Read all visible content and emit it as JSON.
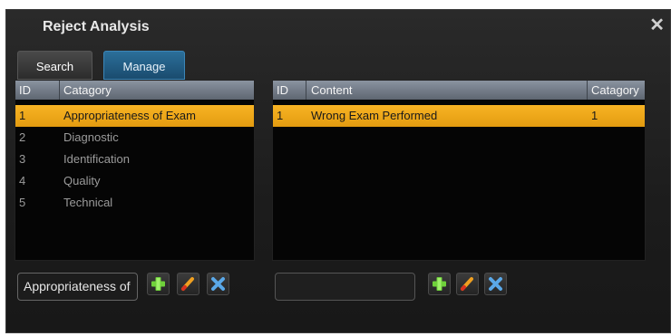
{
  "dialog": {
    "title": "Reject Analysis",
    "close_icon": "close-icon"
  },
  "tabs": [
    {
      "label": "Search"
    },
    {
      "label": "Manage"
    }
  ],
  "categories": {
    "columns": [
      "ID",
      "Catagory"
    ],
    "rows": [
      {
        "id": "1",
        "name": "Appropriateness of Exam",
        "selected": true
      },
      {
        "id": "2",
        "name": "Diagnostic",
        "selected": false
      },
      {
        "id": "3",
        "name": "Identification",
        "selected": false
      },
      {
        "id": "4",
        "name": "Quality",
        "selected": false
      },
      {
        "id": "5",
        "name": "Technical",
        "selected": false
      }
    ],
    "input_value": "Appropriateness of",
    "actions": [
      "add-icon",
      "edit-icon",
      "delete-icon"
    ]
  },
  "contents": {
    "columns": [
      "ID",
      "Content",
      "Catagory"
    ],
    "rows": [
      {
        "id": "1",
        "content": "Wrong Exam Performed",
        "category": "1",
        "selected": true
      }
    ],
    "input_value": "",
    "actions": [
      "add-icon",
      "edit-icon",
      "delete-icon"
    ]
  },
  "colors": {
    "selection": "#f0a81a",
    "header": "#7a828d",
    "tab_active": "#25608a"
  }
}
